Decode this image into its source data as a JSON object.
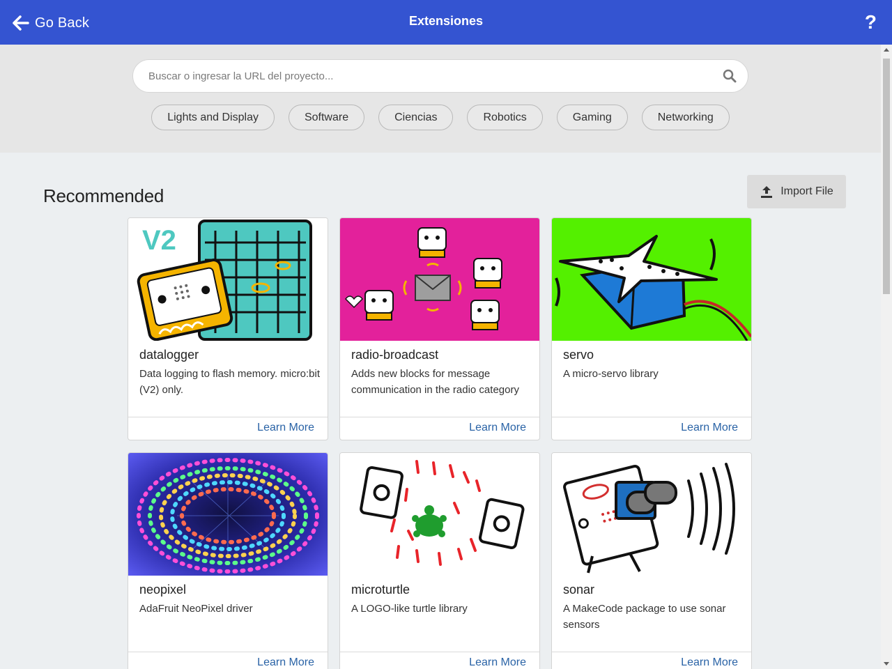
{
  "header": {
    "back_label": "Go Back",
    "title": "Extensiones",
    "help_label": "?",
    "color": "#3454d1"
  },
  "search": {
    "placeholder": "Buscar o ingresar la URL del proyecto...",
    "value": ""
  },
  "categories": [
    "Lights and Display",
    "Software",
    "Ciencias",
    "Robotics",
    "Gaming",
    "Networking"
  ],
  "section": {
    "title": "Recommended",
    "import_label": "Import File"
  },
  "cards": [
    {
      "name": "datalogger",
      "description": "Data logging to flash memory. micro:bit (V2) only.",
      "link": "Learn More",
      "image": "datalogger-illustration"
    },
    {
      "name": "radio-broadcast",
      "description": "Adds new blocks for message communication in the radio category",
      "link": "Learn More",
      "image": "radio-broadcast-illustration"
    },
    {
      "name": "servo",
      "description": "A micro-servo library",
      "link": "Learn More",
      "image": "servo-illustration"
    },
    {
      "name": "neopixel",
      "description": "AdaFruit NeoPixel driver",
      "link": "Learn More",
      "image": "neopixel-photo"
    },
    {
      "name": "microturtle",
      "description": "A LOGO-like turtle library",
      "link": "Learn More",
      "image": "microturtle-illustration"
    },
    {
      "name": "sonar",
      "description": "A MakeCode package to use sonar sensors",
      "link": "Learn More",
      "image": "sonar-illustration"
    }
  ]
}
